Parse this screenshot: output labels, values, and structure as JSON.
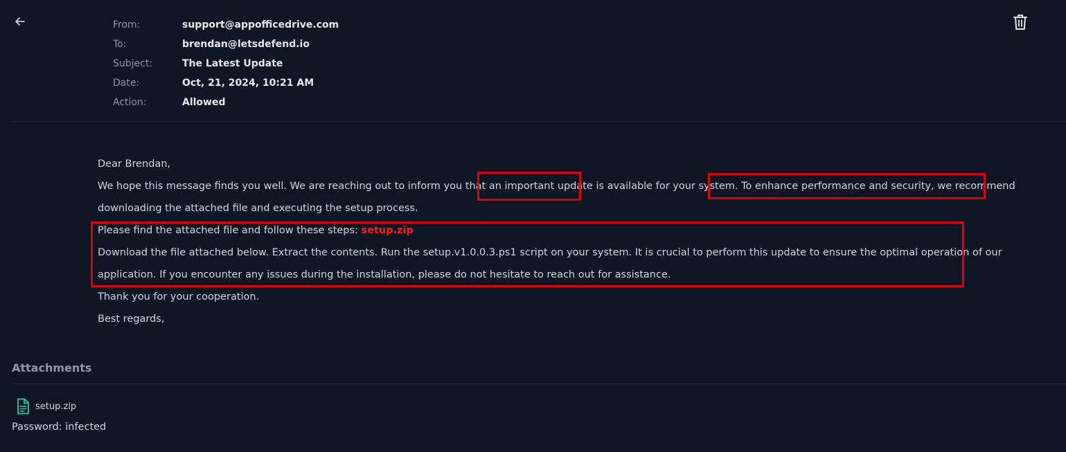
{
  "header": {
    "fields": [
      {
        "label": "From:",
        "value": "support@appofficedrive.com"
      },
      {
        "label": "To:",
        "value": "brendan@letsdefend.io"
      },
      {
        "label": "Subject:",
        "value": "The Latest Update"
      },
      {
        "label": "Date:",
        "value": "Oct, 21, 2024, 10:21 AM"
      },
      {
        "label": "Action:",
        "value": "Allowed"
      }
    ]
  },
  "email_body": {
    "greeting": "Dear Brendan,",
    "para1_line1": "We hope this message finds you well. We are reaching out to inform you that an important update is available for your system. To enhance performance and security, we recommend",
    "para1_line2": "downloading the attached file and executing the setup process.",
    "steps_intro": "Please find the attached file and follow these steps: ",
    "steps_link": "setup.zip",
    "steps_line1": "Download the file attached below. Extract the contents. Run the setup.v1.0.0.3.ps1 script on your system. It is crucial to perform this update to ensure the optimal operation of our",
    "steps_line2": "application. If you encounter any issues during the installation, please do not hesitate to reach out for assistance.",
    "thanks": "Thank you for your cooperation.",
    "signoff": "Best regards,"
  },
  "attachments": {
    "title": "Attachments",
    "file_name": "setup.zip",
    "password": "Password: infected"
  },
  "icons": {
    "back": "arrow-left-icon",
    "delete": "trash-icon",
    "file": "file-document-icon"
  },
  "colors": {
    "background": "#0e1623",
    "highlight_box": "#e0000d",
    "malicious_link": "#ff1a1a",
    "file_icon": "#2bb5a0"
  }
}
